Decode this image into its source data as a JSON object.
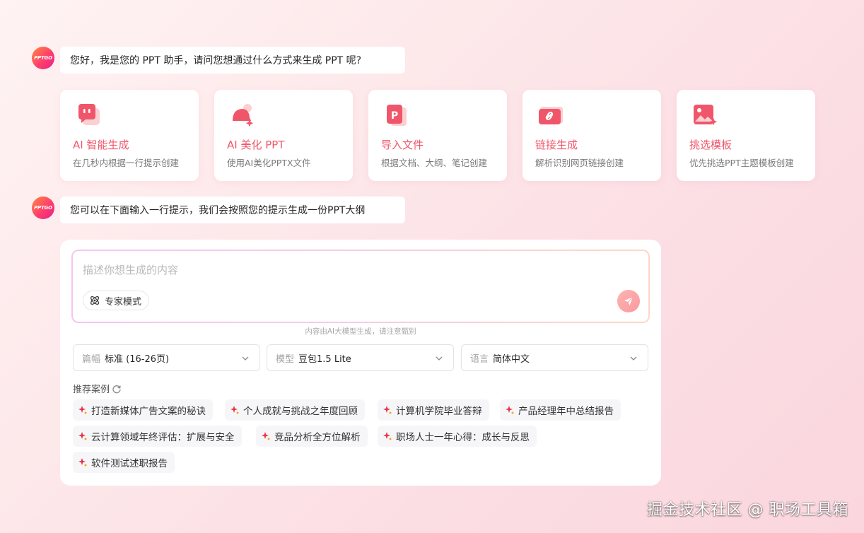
{
  "greeting": {
    "avatar_text": "PPTGO",
    "message": "您好，我是您的 PPT 助手，请问您想通过什么方式来生成 PPT 呢?"
  },
  "options": [
    {
      "icon": "chat-bubble-icon",
      "title": "AI 智能生成",
      "desc": "在几秒内根据一行提示创建"
    },
    {
      "icon": "magic-bell-icon",
      "title": "AI 美化 PPT",
      "desc": "使用AI美化PPTX文件"
    },
    {
      "icon": "ppt-file-icon",
      "title": "导入文件",
      "desc": "根据文档、大纲、笔记创建"
    },
    {
      "icon": "link-icon",
      "title": "链接生成",
      "desc": "解析识别网页链接创建"
    },
    {
      "icon": "template-image-icon",
      "title": "挑选模板",
      "desc": "优先挑选PPT主题模板创建"
    }
  ],
  "prompt_message": {
    "avatar_text": "PPTGO",
    "message": "您可以在下面输入一行提示，我们会按照您的提示生成一份PPT大纲"
  },
  "composer": {
    "placeholder": "描述你想生成的内容",
    "value": "",
    "expert_mode_label": "专家模式",
    "disclaimer": "内容由AI大模型生成，请注意甄别"
  },
  "selects": [
    {
      "label": "篇幅",
      "value": "标准 (16-26页)"
    },
    {
      "label": "模型",
      "value": "豆包1.5 Lite"
    },
    {
      "label": "语言",
      "value": "简体中文"
    }
  ],
  "recommend": {
    "title": "推荐案例",
    "items": [
      "打造新媒体广告文案的秘诀",
      "个人成就与挑战之年度回顾",
      "计算机学院毕业答辩",
      "产品经理年中总结报告",
      "云计算领域年终评估：扩展与安全",
      "竞品分析全方位解析",
      "职场人士一年心得：成长与反思",
      "软件测试述职报告"
    ]
  },
  "watermark": "掘金技术社区 @ 职场工具箱",
  "colors": {
    "accent": "#f0566a",
    "send_button": "#f99aa0",
    "background": "#fde8ea"
  }
}
